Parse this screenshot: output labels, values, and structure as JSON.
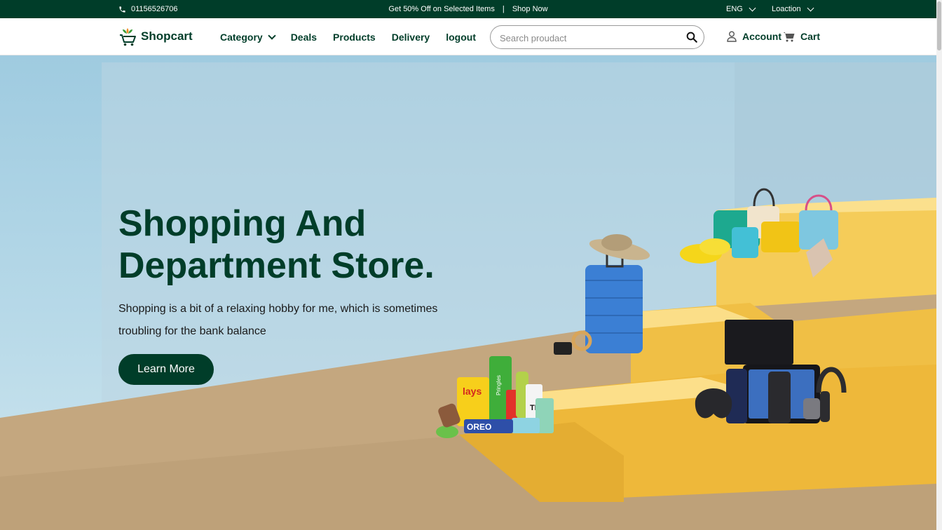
{
  "topbar": {
    "phone": "01156526706",
    "promo": "Get 50% Off on Selected Items",
    "separator": "|",
    "shop_now": "Shop Now",
    "language": "ENG",
    "location": "Loaction"
  },
  "nav": {
    "logo": "Shopcart",
    "menu": [
      "Category",
      "Deals",
      "Products",
      "Delivery",
      "logout"
    ],
    "search_placeholder": "Search proudact",
    "account": "Account",
    "cart": "Cart"
  },
  "hero": {
    "title_line1": "Shopping And",
    "title_line2": "Department Store.",
    "description": "Shopping is a bit of a relaxing hobby for me, which is sometimes troubling for the bank balance",
    "cta": "Learn More",
    "product_labels": {
      "chips": "lays",
      "chips2": "Pringles",
      "tea": "TEA",
      "cookies": "OREO"
    }
  },
  "colors": {
    "brand": "#003d29",
    "accent": "#f8c84a",
    "sky": "#a9d2e6",
    "floor": "#c4a77f"
  },
  "icons": {
    "phone": "phone-icon",
    "search": "search-icon",
    "account": "user-icon",
    "cart": "cart-icon",
    "logo": "cart-logo-icon"
  }
}
